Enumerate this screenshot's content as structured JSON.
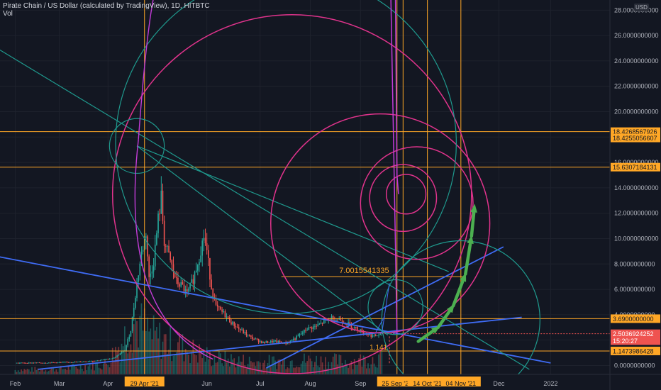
{
  "header": {
    "title": "Pirate Chain / US Dollar (calculated by TradingView), 1D, HITBTC",
    "volume_label": "Vol"
  },
  "currency": "USD",
  "colors": {
    "background": "#131722",
    "grid": "#1e222d",
    "text": "#b2b5be",
    "candle_up": "#26a69a",
    "candle_down": "#ef5350",
    "orange": "#ffa726",
    "blue": "#3f6cf5",
    "teal": "#1f9a8e",
    "magenta": "#e0338c",
    "purple": "#c33cd8",
    "green_arrow": "#4caf50"
  },
  "chart_data": {
    "type": "candlestick",
    "symbol": "Pirate Chain / US Dollar",
    "interval": "1D",
    "exchange": "HITBTC",
    "y_ticks": [
      "28.0000000000",
      "26.0000000000",
      "24.0000000000",
      "22.0000000000",
      "20.0000000000",
      "18.0000000000",
      "16.0000000000",
      "14.0000000000",
      "12.0000000000",
      "10.0000000000",
      "8.0000000000",
      "6.0000000000",
      "4.0000000000",
      "2.0000000000",
      "0.0000000000"
    ],
    "y_tick_values": [
      28,
      26,
      24,
      22,
      20,
      18,
      16,
      14,
      12,
      10,
      8,
      6,
      4,
      2,
      0
    ],
    "ylim": [
      -0.7,
      28.8
    ],
    "x_ticks": [
      {
        "label": "Feb",
        "day": 0
      },
      {
        "label": "Mar",
        "day": 29
      },
      {
        "label": "Apr",
        "day": 61
      },
      {
        "label": "Jun",
        "day": 126
      },
      {
        "label": "Jul",
        "day": 161
      },
      {
        "label": "Aug",
        "day": 194
      },
      {
        "label": "Sep",
        "day": 227
      },
      {
        "label": "Dec",
        "day": 318
      },
      {
        "label": "2022",
        "day": 352
      }
    ],
    "x_labels_highlighted": [
      {
        "label": "29 Apr '21",
        "day": 85
      },
      {
        "label": "25 Sep '21",
        "day": 251
      },
      {
        "label": "14 Oct '21",
        "day": 271
      },
      {
        "label": "04 Nov '21",
        "day": 293
      }
    ],
    "xlim": [
      -10,
      391
    ],
    "price_labels": [
      {
        "text": "18.4268567926",
        "value": 18.427,
        "style": "orange"
      },
      {
        "text": "18.4255056607",
        "value": 17.93,
        "style": "orange"
      },
      {
        "text": "15.6307184131",
        "value": 15.631,
        "style": "orange"
      },
      {
        "text": "3.6900000000",
        "value": 3.69,
        "style": "orange"
      },
      {
        "text": "2.5036924252",
        "value": 2.504,
        "style": "red"
      },
      {
        "text": "15:20:27",
        "value": 1.96,
        "style": "red"
      },
      {
        "text": "1.1473986428",
        "value": 1.147,
        "style": "orange"
      }
    ],
    "horizontal_levels": [
      18.427,
      15.631,
      3.69,
      1.147
    ],
    "vertical_line_days": [
      85,
      251,
      255,
      271,
      293
    ],
    "annotations": [
      {
        "text": "7.0015541335",
        "value": 7.0015541335
      },
      {
        "text": "1.141",
        "value": 1.141
      }
    ],
    "price_path": [
      [
        0,
        0.2
      ],
      [
        20,
        0.22
      ],
      [
        40,
        0.28
      ],
      [
        55,
        0.4
      ],
      [
        65,
        0.6
      ],
      [
        72,
        1.2
      ],
      [
        76,
        2.8
      ],
      [
        80,
        6.5
      ],
      [
        83,
        8.8
      ],
      [
        86,
        10.5
      ],
      [
        88,
        6.8
      ],
      [
        91,
        8.2
      ],
      [
        94,
        11.5
      ],
      [
        96,
        13.2
      ],
      [
        98,
        9.8
      ],
      [
        102,
        8.2
      ],
      [
        106,
        6.6
      ],
      [
        110,
        6.2
      ],
      [
        113,
        5.6
      ],
      [
        117,
        6.8
      ],
      [
        121,
        8.6
      ],
      [
        124,
        10.2
      ],
      [
        126,
        9.0
      ],
      [
        129,
        6.2
      ],
      [
        132,
        4.6
      ],
      [
        137,
        4.1
      ],
      [
        142,
        3.4
      ],
      [
        148,
        2.8
      ],
      [
        155,
        2.2
      ],
      [
        163,
        1.8
      ],
      [
        170,
        1.9
      ],
      [
        178,
        1.75
      ],
      [
        185,
        2.2
      ],
      [
        192,
        2.9
      ],
      [
        198,
        3.1
      ],
      [
        204,
        3.5
      ],
      [
        208,
        3.75
      ],
      [
        214,
        3.6
      ],
      [
        220,
        3.2
      ],
      [
        226,
        2.8
      ],
      [
        231,
        2.5
      ],
      [
        236,
        2.3
      ],
      [
        241,
        2.504
      ]
    ],
    "volume_profile": [
      [
        0,
        0.08
      ],
      [
        30,
        0.1
      ],
      [
        60,
        0.2
      ],
      [
        70,
        0.6
      ],
      [
        78,
        1.0
      ],
      [
        90,
        0.7
      ],
      [
        110,
        0.5
      ],
      [
        130,
        0.3
      ],
      [
        160,
        0.22
      ],
      [
        190,
        0.26
      ],
      [
        220,
        0.24
      ],
      [
        241,
        0.3
      ]
    ]
  }
}
